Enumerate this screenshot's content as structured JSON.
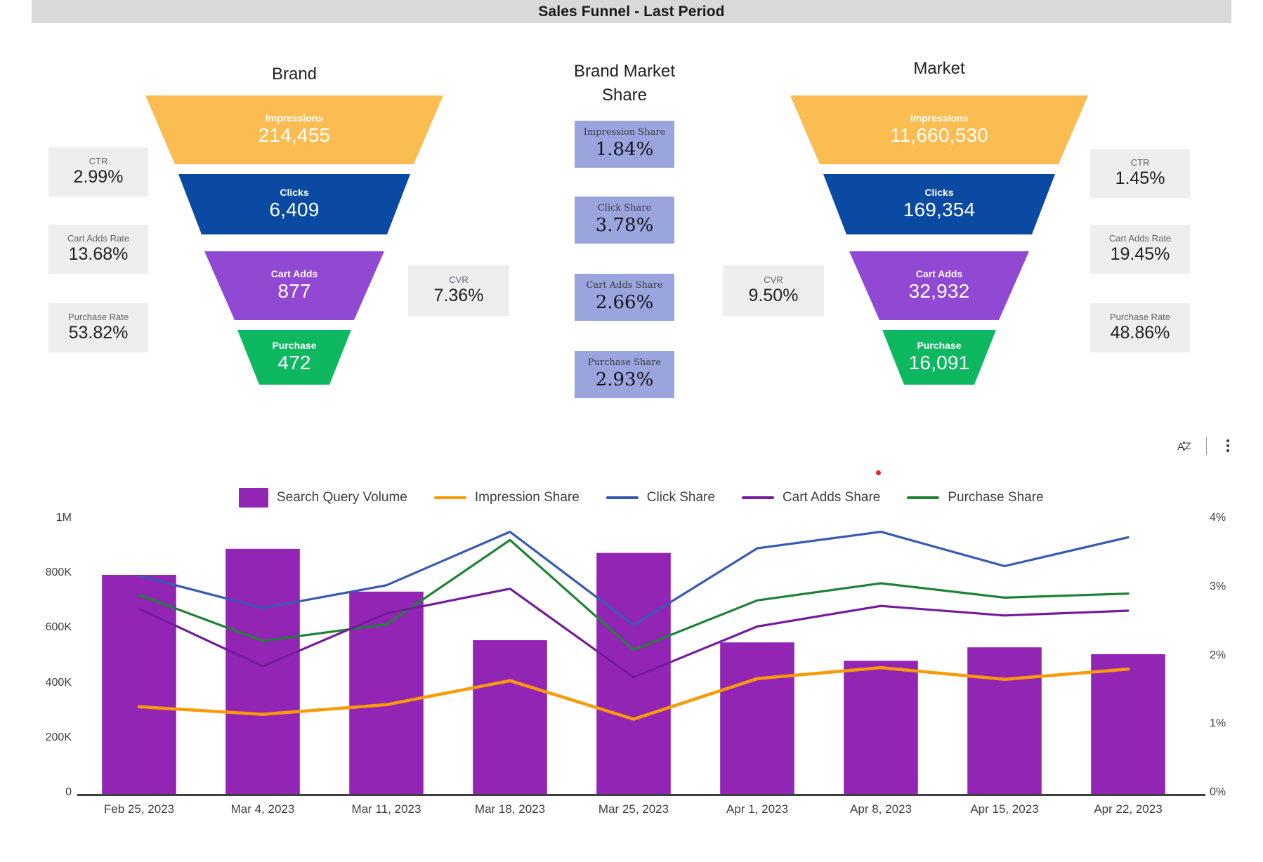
{
  "header": {
    "title": "Sales Funnel - Last Period"
  },
  "funnels": [
    {
      "id": "brand",
      "title": "Brand",
      "stages": [
        {
          "label": "Impressions",
          "value": "214,455",
          "color": "#fbbc52"
        },
        {
          "label": "Clicks",
          "value": "6,409",
          "color": "#0b4aa2"
        },
        {
          "label": "Cart Adds",
          "value": "877",
          "color": "#9148d3"
        },
        {
          "label": "Purchase",
          "value": "472",
          "color": "#0db861"
        }
      ],
      "left_metrics": [
        {
          "label": "CTR",
          "value": "2.99%"
        },
        {
          "label": "Cart Adds Rate",
          "value": "13.68%"
        },
        {
          "label": "Purchase Rate",
          "value": "53.82%"
        }
      ],
      "cvr": {
        "label": "CVR",
        "value": "7.36%"
      }
    },
    {
      "id": "market",
      "title": "Market",
      "stages": [
        {
          "label": "Impressions",
          "value": "11,660,530",
          "color": "#fbbc52"
        },
        {
          "label": "Clicks",
          "value": "169,354",
          "color": "#0b4aa2"
        },
        {
          "label": "Cart Adds",
          "value": "32,932",
          "color": "#9148d3"
        },
        {
          "label": "Purchase",
          "value": "16,091",
          "color": "#0db861"
        }
      ],
      "right_metrics": [
        {
          "label": "CTR",
          "value": "1.45%"
        },
        {
          "label": "Cart Adds Rate",
          "value": "19.45%"
        },
        {
          "label": "Purchase Rate",
          "value": "48.86%"
        }
      ],
      "cvr": {
        "label": "CVR",
        "value": "9.50%"
      }
    }
  ],
  "market_share": {
    "title_line1": "Brand Market",
    "title_line2": "Share",
    "box_color": "#9aa4dd",
    "items": [
      {
        "label": "Impression Share",
        "value": "1.84%"
      },
      {
        "label": "Click Share",
        "value": "3.78%"
      },
      {
        "label": "Cart Adds Share",
        "value": "2.66%"
      },
      {
        "label": "Purchase Share",
        "value": "2.93%"
      }
    ]
  },
  "toolbar": {
    "sort_icon": "sort-az-icon",
    "more_icon": "more-vert-icon"
  },
  "chart_data": {
    "type": "bar",
    "title": "",
    "xlabel": "",
    "ylabel": "",
    "grid": false,
    "legend_position": "top",
    "categories": [
      "Feb 25, 2023",
      "Mar 4, 2023",
      "Mar 11, 2023",
      "Mar 18, 2023",
      "Mar 25, 2023",
      "Apr 1, 2023",
      "Apr 8, 2023",
      "Apr 15, 2023",
      "Apr 22, 2023"
    ],
    "y_left": {
      "label": "",
      "ticks": [
        "0",
        "200K",
        "400K",
        "600K",
        "800K",
        "1M"
      ],
      "tick_values": [
        0,
        200000,
        400000,
        600000,
        800000,
        1000000
      ],
      "ylim": [
        0,
        1000000
      ]
    },
    "y_right": {
      "label": "",
      "ticks": [
        "0%",
        "1%",
        "2%",
        "3%",
        "4%"
      ],
      "tick_values": [
        0,
        1,
        2,
        3,
        4
      ],
      "ylim": [
        0,
        4
      ]
    },
    "series": [
      {
        "name": "Search Query Volume",
        "kind": "bar",
        "axis": "left",
        "color": "#9325b5",
        "values": [
          798000,
          893000,
          737000,
          560000,
          878000,
          552000,
          485000,
          534000,
          509000
        ]
      },
      {
        "name": "Impression Share",
        "kind": "line",
        "axis": "right",
        "color": "#f99a08",
        "values": [
          1.27,
          1.16,
          1.3,
          1.65,
          1.09,
          1.68,
          1.84,
          1.67,
          1.82
        ]
      },
      {
        "name": "Click Share",
        "kind": "line",
        "axis": "right",
        "color": "#3859b3",
        "values": [
          3.18,
          2.71,
          3.04,
          3.82,
          2.46,
          3.58,
          3.82,
          3.32,
          3.74
        ]
      },
      {
        "name": "Cart Adds Share",
        "kind": "line",
        "axis": "right",
        "color": "#741b9c",
        "values": [
          2.7,
          1.86,
          2.63,
          2.99,
          1.7,
          2.44,
          2.74,
          2.6,
          2.67
        ]
      },
      {
        "name": "Purchase Share",
        "kind": "line",
        "axis": "right",
        "color": "#1e8236",
        "values": [
          2.9,
          2.23,
          2.47,
          3.7,
          2.1,
          2.82,
          3.07,
          2.86,
          2.92
        ]
      }
    ]
  }
}
